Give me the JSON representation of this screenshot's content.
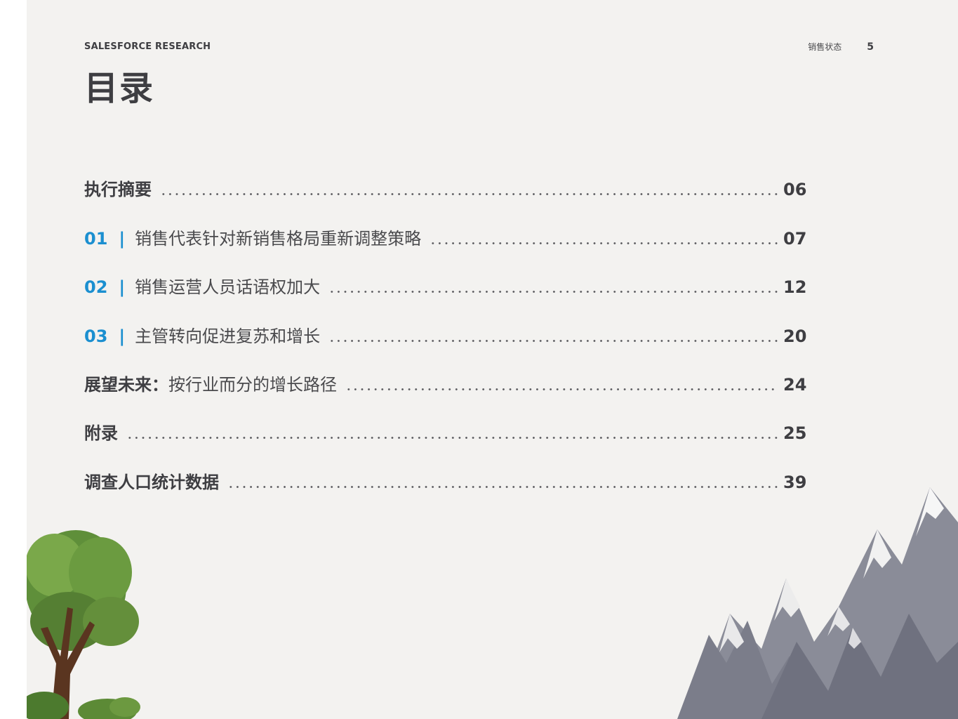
{
  "header": {
    "brand": "SALESFORCE RESEARCH",
    "section": "销售状态",
    "page_number": "5"
  },
  "title": "目录",
  "toc": [
    {
      "num": "",
      "sep": "",
      "bold": "执行摘要",
      "text": "",
      "page": "06"
    },
    {
      "num": "01",
      "sep": "|",
      "bold": "",
      "text": "销售代表针对新销售格局重新调整策略",
      "page": "07"
    },
    {
      "num": "02",
      "sep": "|",
      "bold": "",
      "text": "销售运营人员话语权加大",
      "page": "12"
    },
    {
      "num": "03",
      "sep": "|",
      "bold": "",
      "text": "主管转向促进复苏和增长",
      "page": "20"
    },
    {
      "num": "",
      "sep": "",
      "bold": "展望未来：",
      "text": "按行业而分的增长路径",
      "page": "24"
    },
    {
      "num": "",
      "sep": "",
      "bold": "附录",
      "text": "",
      "page": "25"
    },
    {
      "num": "",
      "sep": "",
      "bold": "调查人口统计数据",
      "text": "",
      "page": "39"
    }
  ],
  "colors": {
    "accent": "#1b8fd0",
    "page_bg": "#f3f2f0",
    "text": "#3e3e42"
  },
  "illustrations": [
    "tree-illustration",
    "mountains-illustration"
  ]
}
